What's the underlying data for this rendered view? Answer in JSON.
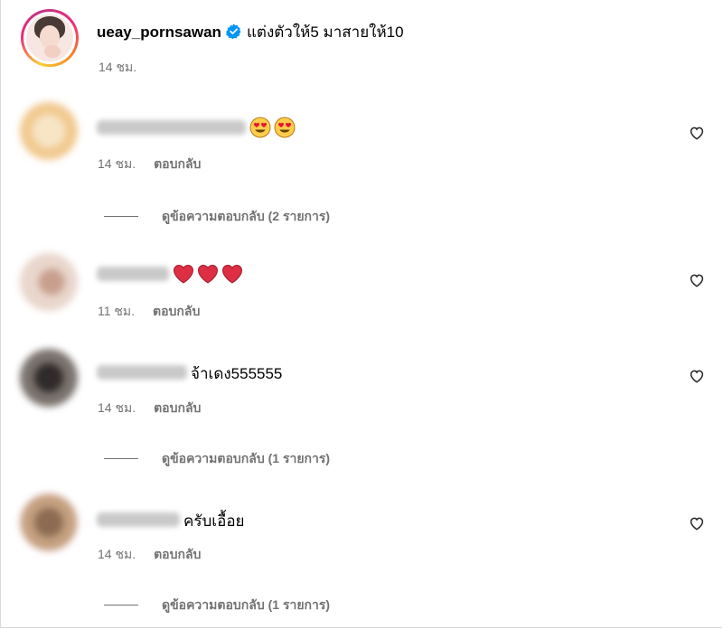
{
  "caption": {
    "username": "ueay_pornsawan",
    "text": "แต่งตัวให้5 มาสายให้10",
    "time": "14 ชม."
  },
  "comments": [
    {
      "username_blurred": true,
      "text": "",
      "emojis": [
        "heart-eyes",
        "heart-eyes"
      ],
      "time": "14 ชม.",
      "reply_label": "ตอบกลับ",
      "view_replies": "ดูข้อความตอบกลับ (2 รายการ)",
      "avatar_color": "#f3d7a8"
    },
    {
      "username_blurred": true,
      "text": "",
      "emojis": [
        "red-heart",
        "red-heart",
        "red-heart"
      ],
      "time": "11 ชม.",
      "reply_label": "ตอบกลับ",
      "view_replies": "",
      "avatar_color": "#d7b7a8"
    },
    {
      "username_blurred": true,
      "text": "จ้าเดง555555",
      "emojis": [],
      "time": "14 ชม.",
      "reply_label": "ตอบกลับ",
      "view_replies": "ดูข้อความตอบกลับ (1 รายการ)",
      "avatar_color": "#4a4443"
    },
    {
      "username_blurred": true,
      "text": "ครับเอื้อย",
      "emojis": [],
      "time": "14 ชม.",
      "reply_label": "ตอบกลับ",
      "view_replies": "ดูข้อความตอบกลับ (1 รายการ)",
      "avatar_color": "#a98466"
    }
  ],
  "colors": {
    "secondary_text": "#737373",
    "verified_blue": "#0095f6"
  }
}
